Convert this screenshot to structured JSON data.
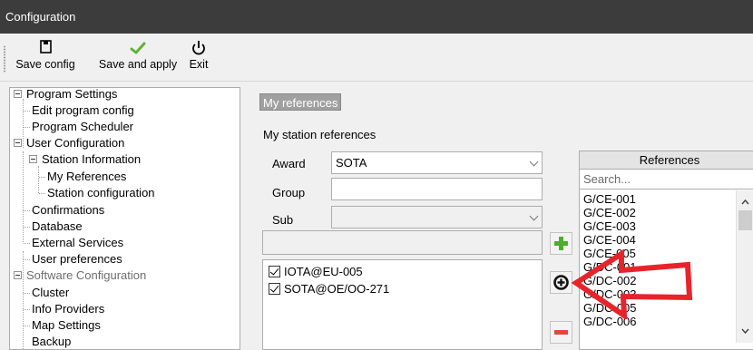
{
  "window": {
    "title": "Configuration"
  },
  "toolbar": {
    "save_config": "Save config",
    "save_apply": "Save and apply",
    "exit": "Exit"
  },
  "tree": {
    "program_settings": "Program Settings",
    "edit_program_config": "Edit program config",
    "program_scheduler": "Program Scheduler",
    "user_configuration": "User Configuration",
    "station_information": "Station Information",
    "my_references": "My References",
    "station_configuration": "Station configuration",
    "confirmations": "Confirmations",
    "database": "Database",
    "external_services": "External Services",
    "user_preferences": "User preferences",
    "software_configuration": "Software Configuration",
    "cluster": "Cluster",
    "info_providers": "Info Providers",
    "map_settings": "Map Settings",
    "backup": "Backup"
  },
  "main": {
    "section_label": "My references",
    "heading": "My station references",
    "award_label": "Award",
    "award_value": "SOTA",
    "group_label": "Group",
    "group_value": "",
    "sub_label": "Sub",
    "sub_value": "",
    "add_input_value": "",
    "my_refs": [
      "IOTA@EU-005",
      "SOTA@OE/OO-271"
    ]
  },
  "references": {
    "header": "References",
    "search_placeholder": "Search...",
    "items": [
      "G/CE-001",
      "G/CE-002",
      "G/CE-003",
      "G/CE-004",
      "G/CE-005",
      "G/DC-001",
      "G/DC-002",
      "G/DC-003",
      "G/DC-005",
      "G/DC-006"
    ]
  },
  "colors": {
    "titlebar": "#3c3c3c",
    "add_green": "#4caf2a",
    "remove_red": "#e0483a",
    "annotation_arrow": "#e8242b"
  }
}
